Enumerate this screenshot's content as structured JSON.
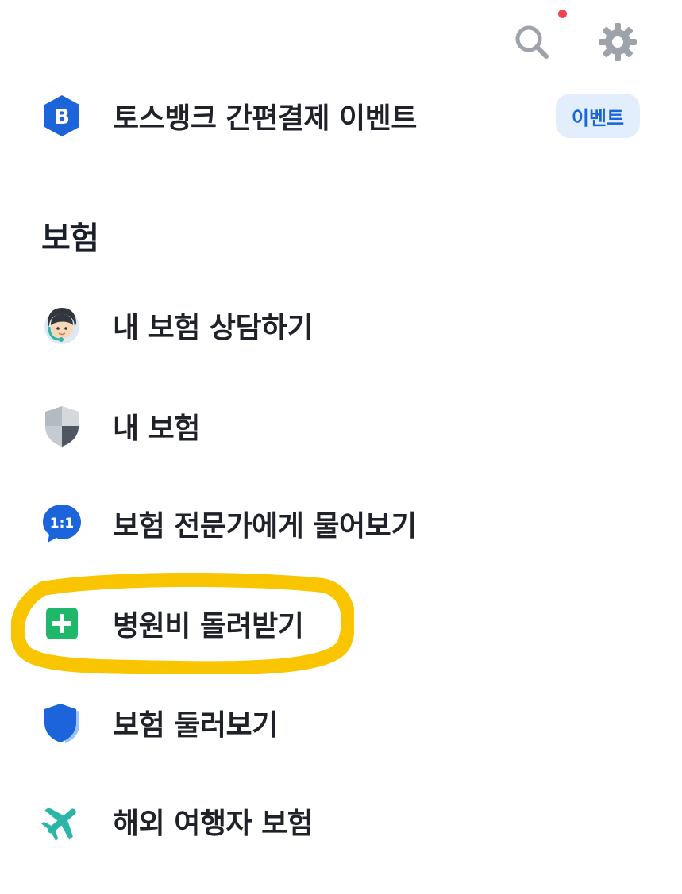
{
  "top_bar": {
    "search_icon": "search-icon",
    "settings_icon": "gear-icon",
    "notification_dot_color": "#f04452"
  },
  "promo": {
    "icon": "toss-bank-b-icon",
    "icon_letter": "B",
    "label": "토스뱅크 간편결제 이벤트",
    "badge": "이벤트"
  },
  "section": {
    "title": "보험",
    "items": [
      {
        "icon": "consultant-avatar-icon",
        "label": "내 보험 상담하기"
      },
      {
        "icon": "shield-icon",
        "label": "내 보험"
      },
      {
        "icon": "chat-bubble-1on1-icon",
        "icon_text": "1:1",
        "label": "보험 전문가에게 물어보기"
      },
      {
        "icon": "plus-square-icon",
        "label": "병원비 돌려받기",
        "highlighted": true
      },
      {
        "icon": "blue-shield-icon",
        "label": "보험 둘러보기"
      },
      {
        "icon": "airplane-icon",
        "label": "해외 여행자 보험"
      }
    ]
  },
  "colors": {
    "accent_blue": "#1b64da",
    "badge_bg": "#e3eefc",
    "highlight": "#f9c400",
    "plus_green": "#1fb86b"
  }
}
